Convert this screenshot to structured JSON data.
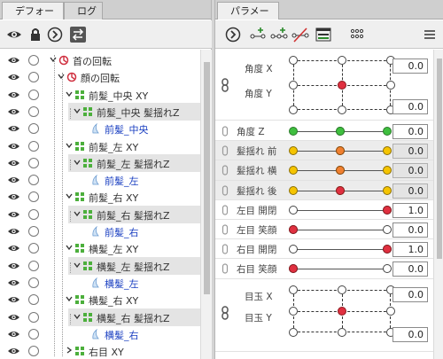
{
  "left_panel": {
    "tabs": [
      "デフォーマ",
      "ログ"
    ],
    "tree": [
      {
        "label": "首の回転",
        "type": "rotate",
        "color": "normal"
      },
      {
        "label": "顔の回転",
        "type": "rotate",
        "color": "normal"
      },
      {
        "label": "前髪_中央 XY",
        "type": "warp",
        "color": "normal"
      },
      {
        "label": "前髪_中央 髪揺れZ",
        "type": "warp",
        "color": "normal"
      },
      {
        "label": "前髪_中央",
        "type": "art",
        "color": "blue"
      },
      {
        "label": "前髪_左 XY",
        "type": "warp",
        "color": "normal"
      },
      {
        "label": "前髪_左 髪揺れZ",
        "type": "warp",
        "color": "normal"
      },
      {
        "label": "前髪_左",
        "type": "art",
        "color": "blue"
      },
      {
        "label": "前髪_右 XY",
        "type": "warp",
        "color": "normal"
      },
      {
        "label": "前髪_右 髪揺れZ",
        "type": "warp",
        "color": "normal"
      },
      {
        "label": "前髪_右",
        "type": "art",
        "color": "blue"
      },
      {
        "label": "横髪_左 XY",
        "type": "warp",
        "color": "normal"
      },
      {
        "label": "横髪_左 髪揺れZ",
        "type": "warp",
        "color": "normal"
      },
      {
        "label": "横髪_左",
        "type": "art",
        "color": "blue"
      },
      {
        "label": "横髪_右 XY",
        "type": "warp",
        "color": "normal"
      },
      {
        "label": "横髪_右 髪揺れZ",
        "type": "warp",
        "color": "normal"
      },
      {
        "label": "横髪_右",
        "type": "art",
        "color": "blue"
      },
      {
        "label": "右目 XY",
        "type": "warp",
        "color": "normal"
      }
    ]
  },
  "right_panel": {
    "tab": "パラメータ",
    "angle_xy": {
      "label_x": "角度 X",
      "label_y": "角度 Y",
      "value_x": "0.0",
      "value_y": "0.0"
    },
    "params": [
      {
        "label": "角度 Z",
        "value": "0.0",
        "knob": 0.5,
        "kcolor": "green",
        "shaded": false,
        "dim": false
      },
      {
        "label": "髪揺れ 前",
        "value": "0.0",
        "knob": 0.5,
        "kcolor": "orange",
        "shaded": true,
        "dim": false
      },
      {
        "label": "髪揺れ 横",
        "value": "0.0",
        "knob": 0.5,
        "kcolor": "orange",
        "shaded": true,
        "dim": false
      },
      {
        "label": "髪揺れ 後",
        "value": "0.0",
        "knob": 0.5,
        "kcolor": "red",
        "shaded": true,
        "dim": false
      },
      {
        "label": "左目 開閉",
        "value": "1.0",
        "knob": 1.0,
        "kcolor": "red",
        "shaded": false,
        "dim": false
      },
      {
        "label": "左目 笑顔",
        "value": "0.0",
        "knob": 0.0,
        "kcolor": "red",
        "shaded": false,
        "dim": false
      },
      {
        "label": "右目 開閉",
        "value": "1.0",
        "knob": 1.0,
        "kcolor": "red",
        "shaded": false,
        "dim": false
      },
      {
        "label": "右目 笑顔",
        "value": "0.0",
        "knob": 0.0,
        "kcolor": "red",
        "shaded": false,
        "dim": false
      }
    ],
    "eye_xy": {
      "label_x": "目玉 X",
      "label_y": "目玉 Y",
      "value_x": "0.0",
      "value_y": "0.0"
    }
  }
}
